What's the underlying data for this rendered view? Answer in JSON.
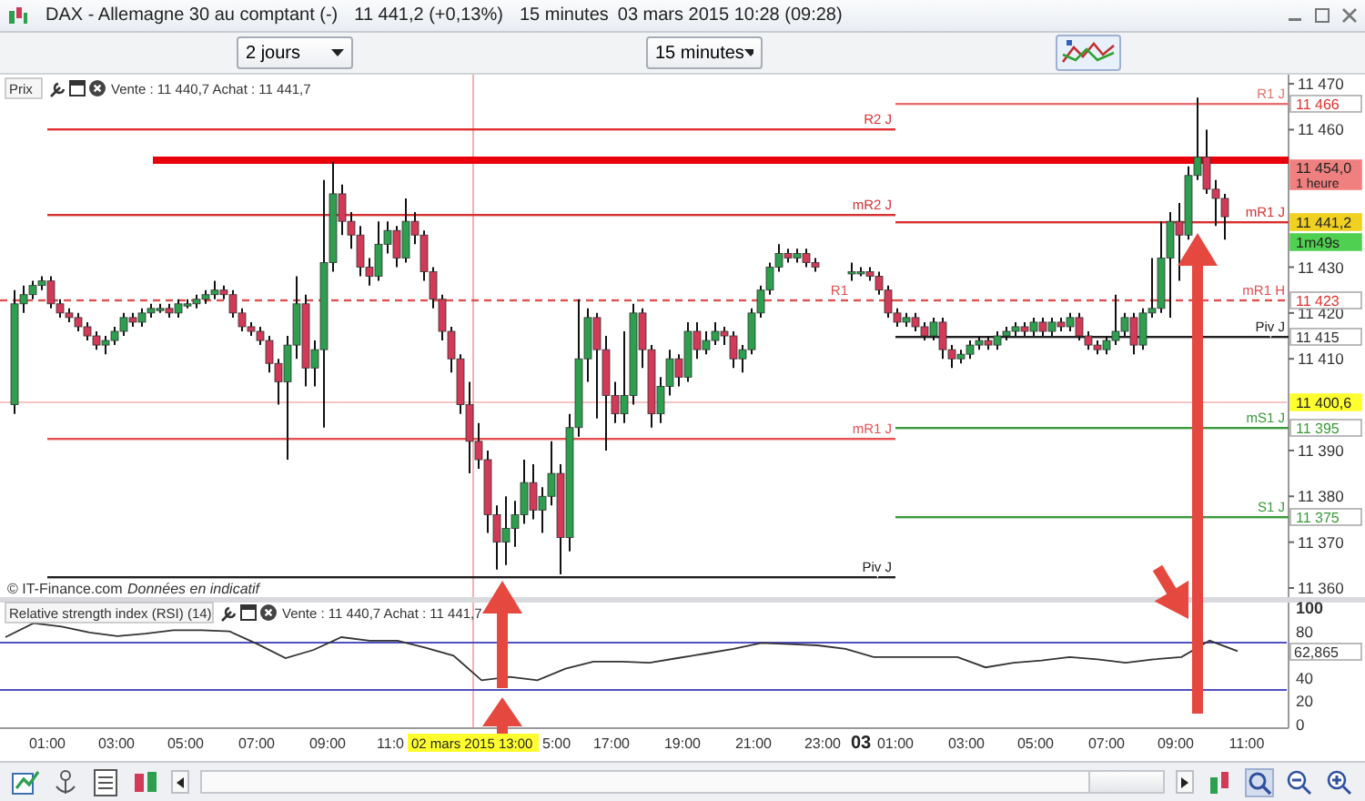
{
  "window": {
    "title": "DAX - Allemagne 30 au comptant (-)",
    "quote": "11 441,2 (+0,13%)",
    "interval": "15 minutes",
    "timestamp": "03 mars 2015 10:28 (09:28)"
  },
  "toolbar": {
    "period": "2 jours",
    "interval": "15 minutes"
  },
  "price_panel": {
    "label": "Prix",
    "quote": "Vente : 11 440,7 Achat : 11 441,7",
    "chart_data": {
      "type": "candlestick",
      "ylim": [
        11360,
        11472
      ],
      "yticks": [
        {
          "value": 11470,
          "label": "11 470"
        },
        {
          "value": 11460,
          "label": "11 460"
        },
        {
          "value": 11430,
          "label": "11 430"
        },
        {
          "value": 11420,
          "label": "11 420"
        },
        {
          "value": 11410,
          "label": "11 410"
        },
        {
          "value": 11390,
          "label": "11 390"
        },
        {
          "value": 11380,
          "label": "11 380"
        },
        {
          "value": 11370,
          "label": "11 370"
        },
        {
          "value": 11360,
          "label": "11 360"
        }
      ],
      "ohlc": [
        [
          11400,
          11425,
          11398,
          11422
        ],
        [
          11422,
          11426,
          11420,
          11424
        ],
        [
          11424,
          11427,
          11423,
          11426
        ],
        [
          11426,
          11428,
          11425,
          11427
        ],
        [
          11427,
          11428,
          11421,
          11422
        ],
        [
          11422,
          11423,
          11419,
          11420
        ],
        [
          11420,
          11421,
          11418,
          11419
        ],
        [
          11419,
          11420,
          11416,
          11417
        ],
        [
          11417,
          11418,
          11414,
          11415
        ],
        [
          11415,
          11416,
          11412,
          11413
        ],
        [
          11413,
          11415,
          11411,
          11414
        ],
        [
          11414,
          11417,
          11413,
          11416
        ],
        [
          11416,
          11420,
          11415,
          11419
        ],
        [
          11419,
          11420,
          11417,
          11418
        ],
        [
          11418,
          11421,
          11417,
          11420
        ],
        [
          11420,
          11422,
          11419,
          11421
        ],
        [
          11421,
          11422,
          11420,
          11421
        ],
        [
          11421,
          11422,
          11419,
          11420
        ],
        [
          11420,
          11423,
          11419,
          11422
        ],
        [
          11422,
          11423,
          11421,
          11422
        ],
        [
          11422,
          11424,
          11421,
          11423
        ],
        [
          11423,
          11425,
          11422,
          11424
        ],
        [
          11424,
          11427,
          11423,
          11425
        ],
        [
          11425,
          11426,
          11423,
          11424
        ],
        [
          11424,
          11425,
          11419,
          11420
        ],
        [
          11420,
          11421,
          11416,
          11417
        ],
        [
          11417,
          11418,
          11415,
          11416
        ],
        [
          11416,
          11417,
          11413,
          11414
        ],
        [
          11414,
          11415,
          11407,
          11409
        ],
        [
          11409,
          11410,
          11400,
          11405
        ],
        [
          11405,
          11415,
          11388,
          11413
        ],
        [
          11413,
          11428,
          11410,
          11422
        ],
        [
          11422,
          11424,
          11404,
          11408
        ],
        [
          11408,
          11414,
          11404,
          11412
        ],
        [
          11412,
          11449,
          11395,
          11431
        ],
        [
          11431,
          11453,
          11429,
          11446
        ],
        [
          11446,
          11448,
          11437,
          11440
        ],
        [
          11440,
          11442,
          11434,
          11437
        ],
        [
          11437,
          11439,
          11428,
          11430
        ],
        [
          11430,
          11432,
          11426,
          11428
        ],
        [
          11428,
          11440,
          11427,
          11435
        ],
        [
          11435,
          11440,
          11433,
          11438
        ],
        [
          11438,
          11439,
          11430,
          11432
        ],
        [
          11432,
          11445,
          11431,
          11440
        ],
        [
          11440,
          11442,
          11435,
          11437
        ],
        [
          11437,
          11438,
          11427,
          11429
        ],
        [
          11429,
          11430,
          11421,
          11423
        ],
        [
          11423,
          11424,
          11414,
          11416
        ],
        [
          11416,
          11417,
          11407,
          11410
        ],
        [
          11410,
          11411,
          11398,
          11400
        ],
        [
          11400,
          11405,
          11385,
          11392
        ],
        [
          11392,
          11396,
          11386,
          11388
        ],
        [
          11388,
          11390,
          11372,
          11376
        ],
        [
          11376,
          11378,
          11364,
          11370
        ],
        [
          11370,
          11380,
          11365,
          11373
        ],
        [
          11373,
          11379,
          11369,
          11376
        ],
        [
          11376,
          11388,
          11374,
          11383
        ],
        [
          11383,
          11387,
          11375,
          11377
        ],
        [
          11377,
          11382,
          11372,
          11380
        ],
        [
          11380,
          11392,
          11378,
          11385
        ],
        [
          11385,
          11387,
          11363,
          11371
        ],
        [
          11371,
          11398,
          11368,
          11395
        ],
        [
          11395,
          11423,
          11393,
          11410
        ],
        [
          11410,
          11421,
          11405,
          11419
        ],
        [
          11419,
          11420,
          11397,
          11412
        ],
        [
          11412,
          11415,
          11390,
          11402
        ],
        [
          11402,
          11405,
          11396,
          11398
        ],
        [
          11398,
          11416,
          11396,
          11402
        ],
        [
          11402,
          11422,
          11400,
          11420
        ],
        [
          11420,
          11421,
          11408,
          11412
        ],
        [
          11412,
          11413,
          11395,
          11398
        ],
        [
          11398,
          11406,
          11396,
          11404
        ],
        [
          11404,
          11412,
          11402,
          11410
        ],
        [
          11410,
          11411,
          11404,
          11406
        ],
        [
          11406,
          11418,
          11405,
          11416
        ],
        [
          11416,
          11418,
          11410,
          11412
        ],
        [
          11412,
          11416,
          11411,
          11414
        ],
        [
          11414,
          11418,
          11413,
          11416
        ],
        [
          11416,
          11417,
          11413,
          11415
        ],
        [
          11415,
          11416,
          11408,
          11410
        ],
        [
          11410,
          11413,
          11407,
          11412
        ],
        [
          11412,
          11421,
          11411,
          11420
        ],
        [
          11420,
          11426,
          11419,
          11425
        ],
        [
          11425,
          11431,
          11424,
          11430
        ],
        [
          11430,
          11435,
          11429,
          11433
        ],
        [
          11433,
          11434,
          11431,
          11432
        ],
        [
          11432,
          11434,
          11431,
          11433
        ],
        [
          11433,
          11434,
          11430,
          11431
        ],
        [
          11431,
          11432,
          11429,
          11430
        ],
        null,
        null,
        null,
        [
          11429,
          11431,
          11427,
          11429
        ],
        [
          11429,
          11430,
          11428,
          11429
        ],
        [
          11429,
          11430,
          11427,
          11428
        ],
        [
          11428,
          11429,
          11424,
          11425
        ],
        [
          11425,
          11426,
          11419,
          11420
        ],
        [
          11420,
          11421,
          11417,
          11418
        ],
        [
          11418,
          11420,
          11417,
          11419
        ],
        [
          11419,
          11420,
          11416,
          11417
        ],
        [
          11417,
          11418,
          11414,
          11415
        ],
        [
          11415,
          11419,
          11414,
          11418
        ],
        [
          11418,
          11419,
          11410,
          11412
        ],
        [
          11412,
          11413,
          11408,
          11410
        ],
        [
          11410,
          11412,
          11409,
          11411
        ],
        [
          11411,
          11414,
          11410,
          11413
        ],
        [
          11413,
          11415,
          11412,
          11414
        ],
        [
          11414,
          11415,
          11412,
          11413
        ],
        [
          11413,
          11416,
          11412,
          11415
        ],
        [
          11415,
          11417,
          11414,
          11416
        ],
        [
          11416,
          11418,
          11415,
          11417
        ],
        [
          11417,
          11418,
          11415,
          11416
        ],
        [
          11416,
          11419,
          11415,
          11418
        ],
        [
          11418,
          11419,
          11415,
          11416
        ],
        [
          11416,
          11419,
          11415,
          11418
        ],
        [
          11418,
          11419,
          11416,
          11417
        ],
        [
          11417,
          11420,
          11416,
          11419
        ],
        [
          11419,
          11420,
          11414,
          11415
        ],
        [
          11415,
          11416,
          11412,
          11413
        ],
        [
          11413,
          11414,
          11411,
          11412
        ],
        [
          11412,
          11415,
          11411,
          11414
        ],
        [
          11414,
          11424,
          11413,
          11416
        ],
        [
          11416,
          11420,
          11415,
          11419
        ],
        [
          11419,
          11420,
          11411,
          11413
        ],
        [
          11413,
          11421,
          11412,
          11420
        ],
        [
          11420,
          11432,
          11419,
          11421
        ],
        [
          11421,
          11440,
          11420,
          11432
        ],
        [
          11432,
          11442,
          11419,
          11440
        ],
        [
          11440,
          11444,
          11427,
          11437
        ],
        [
          11437,
          11452,
          11436,
          11450
        ],
        [
          11450,
          11467,
          11449,
          11454
        ],
        [
          11454,
          11460,
          11446,
          11447
        ],
        [
          11447,
          11449,
          11439,
          11445
        ],
        [
          11445,
          11446,
          11436,
          11441
        ]
      ]
    },
    "levels": [
      {
        "label": "R2 J",
        "kind": "solid",
        "color": "#e03030"
      },
      {
        "kind": "thick",
        "color": "#e8000b"
      },
      {
        "label": "mR2 J",
        "kind": "solid",
        "color": "#d83030"
      },
      {
        "label": "R1",
        "kind": "dashed",
        "color": "#e05050"
      },
      {
        "label": "mR1 J",
        "kind": "solid",
        "color": "#e85050"
      },
      {
        "label": "Piv J",
        "kind": "solid",
        "color": "#202020"
      },
      {
        "label": "R1 J",
        "kind": "solid",
        "color": "#e87070"
      },
      {
        "label": "mR1 J",
        "kind": "solid",
        "color": "#d83030"
      },
      {
        "label": "mR1 H",
        "kind": "dashed",
        "color": "#e05050"
      },
      {
        "label": "Piv J",
        "kind": "solid",
        "color": "#202020"
      },
      {
        "label": "mS1 J",
        "kind": "solid",
        "color": "#3a9a3a"
      },
      {
        "label": "S1 J",
        "kind": "solid",
        "color": "#3a9a3a"
      }
    ],
    "tags": [
      {
        "text": "11 466",
        "kind": "outline",
        "color": "#e03030"
      },
      {
        "text": "11 454,0",
        "subtext": "1 heure",
        "kind": "filled",
        "color": "#f08080"
      },
      {
        "text": "11 441,2",
        "kind": "filled",
        "color": "#f0d020"
      },
      {
        "text": "1m49s",
        "kind": "filled",
        "color": "#50d050"
      },
      {
        "text": "11 423",
        "kind": "outline",
        "color": "#e03030"
      },
      {
        "text": "11 415",
        "kind": "outline",
        "color": "#303030"
      },
      {
        "text": "11 400,6",
        "kind": "filled",
        "color": "#ffff30"
      },
      {
        "text": "11 395",
        "kind": "outline",
        "color": "#3a9a3a"
      },
      {
        "text": "11 375",
        "kind": "outline",
        "color": "#3a9a3a"
      }
    ],
    "credit": "© IT-Finance.com",
    "disclaimer": "Données en indicatif"
  },
  "rsi_panel": {
    "label": "Relative strength index (RSI) (14)",
    "quote": "Vente : 11 440,7 Achat : 11 441,7",
    "value_tag": "62,865",
    "chart_data": {
      "type": "line",
      "ylim": [
        0,
        100
      ],
      "yticks": [
        0,
        20,
        40,
        80,
        100
      ],
      "series": [
        {
          "color": "#333333",
          "values": [
            75,
            87,
            84,
            79,
            76,
            78,
            81,
            81,
            80,
            69,
            57,
            64,
            75,
            72,
            72,
            66,
            59,
            38,
            41,
            38,
            48,
            54,
            54,
            53,
            57,
            61,
            65,
            70,
            69,
            68,
            65,
            58,
            58,
            58,
            58,
            49,
            53,
            55,
            58,
            56,
            53,
            56,
            58,
            72,
            63
          ]
        }
      ]
    }
  },
  "time_axis": {
    "labels": [
      {
        "text": "01:00",
        "kind": "hour"
      },
      {
        "text": "03:00",
        "kind": "hour"
      },
      {
        "text": "05:00",
        "kind": "hour"
      },
      {
        "text": "07:00",
        "kind": "hour"
      },
      {
        "text": "09:00",
        "kind": "hour"
      },
      {
        "text": "11:0",
        "kind": "hour"
      },
      {
        "text": "5:00",
        "kind": "hour"
      },
      {
        "text": "17:00",
        "kind": "hour"
      },
      {
        "text": "19:00",
        "kind": "hour"
      },
      {
        "text": "21:00",
        "kind": "hour"
      },
      {
        "text": "23:00",
        "kind": "hour"
      },
      {
        "text": "03",
        "kind": "day"
      },
      {
        "text": "01:00",
        "kind": "hour"
      },
      {
        "text": "03:00",
        "kind": "hour"
      },
      {
        "text": "05:00",
        "kind": "hour"
      },
      {
        "text": "07:00",
        "kind": "hour"
      },
      {
        "text": "09:00",
        "kind": "hour"
      },
      {
        "text": "11:00",
        "kind": "hour"
      }
    ],
    "cursor_label": "02 mars 2015 13:00"
  }
}
